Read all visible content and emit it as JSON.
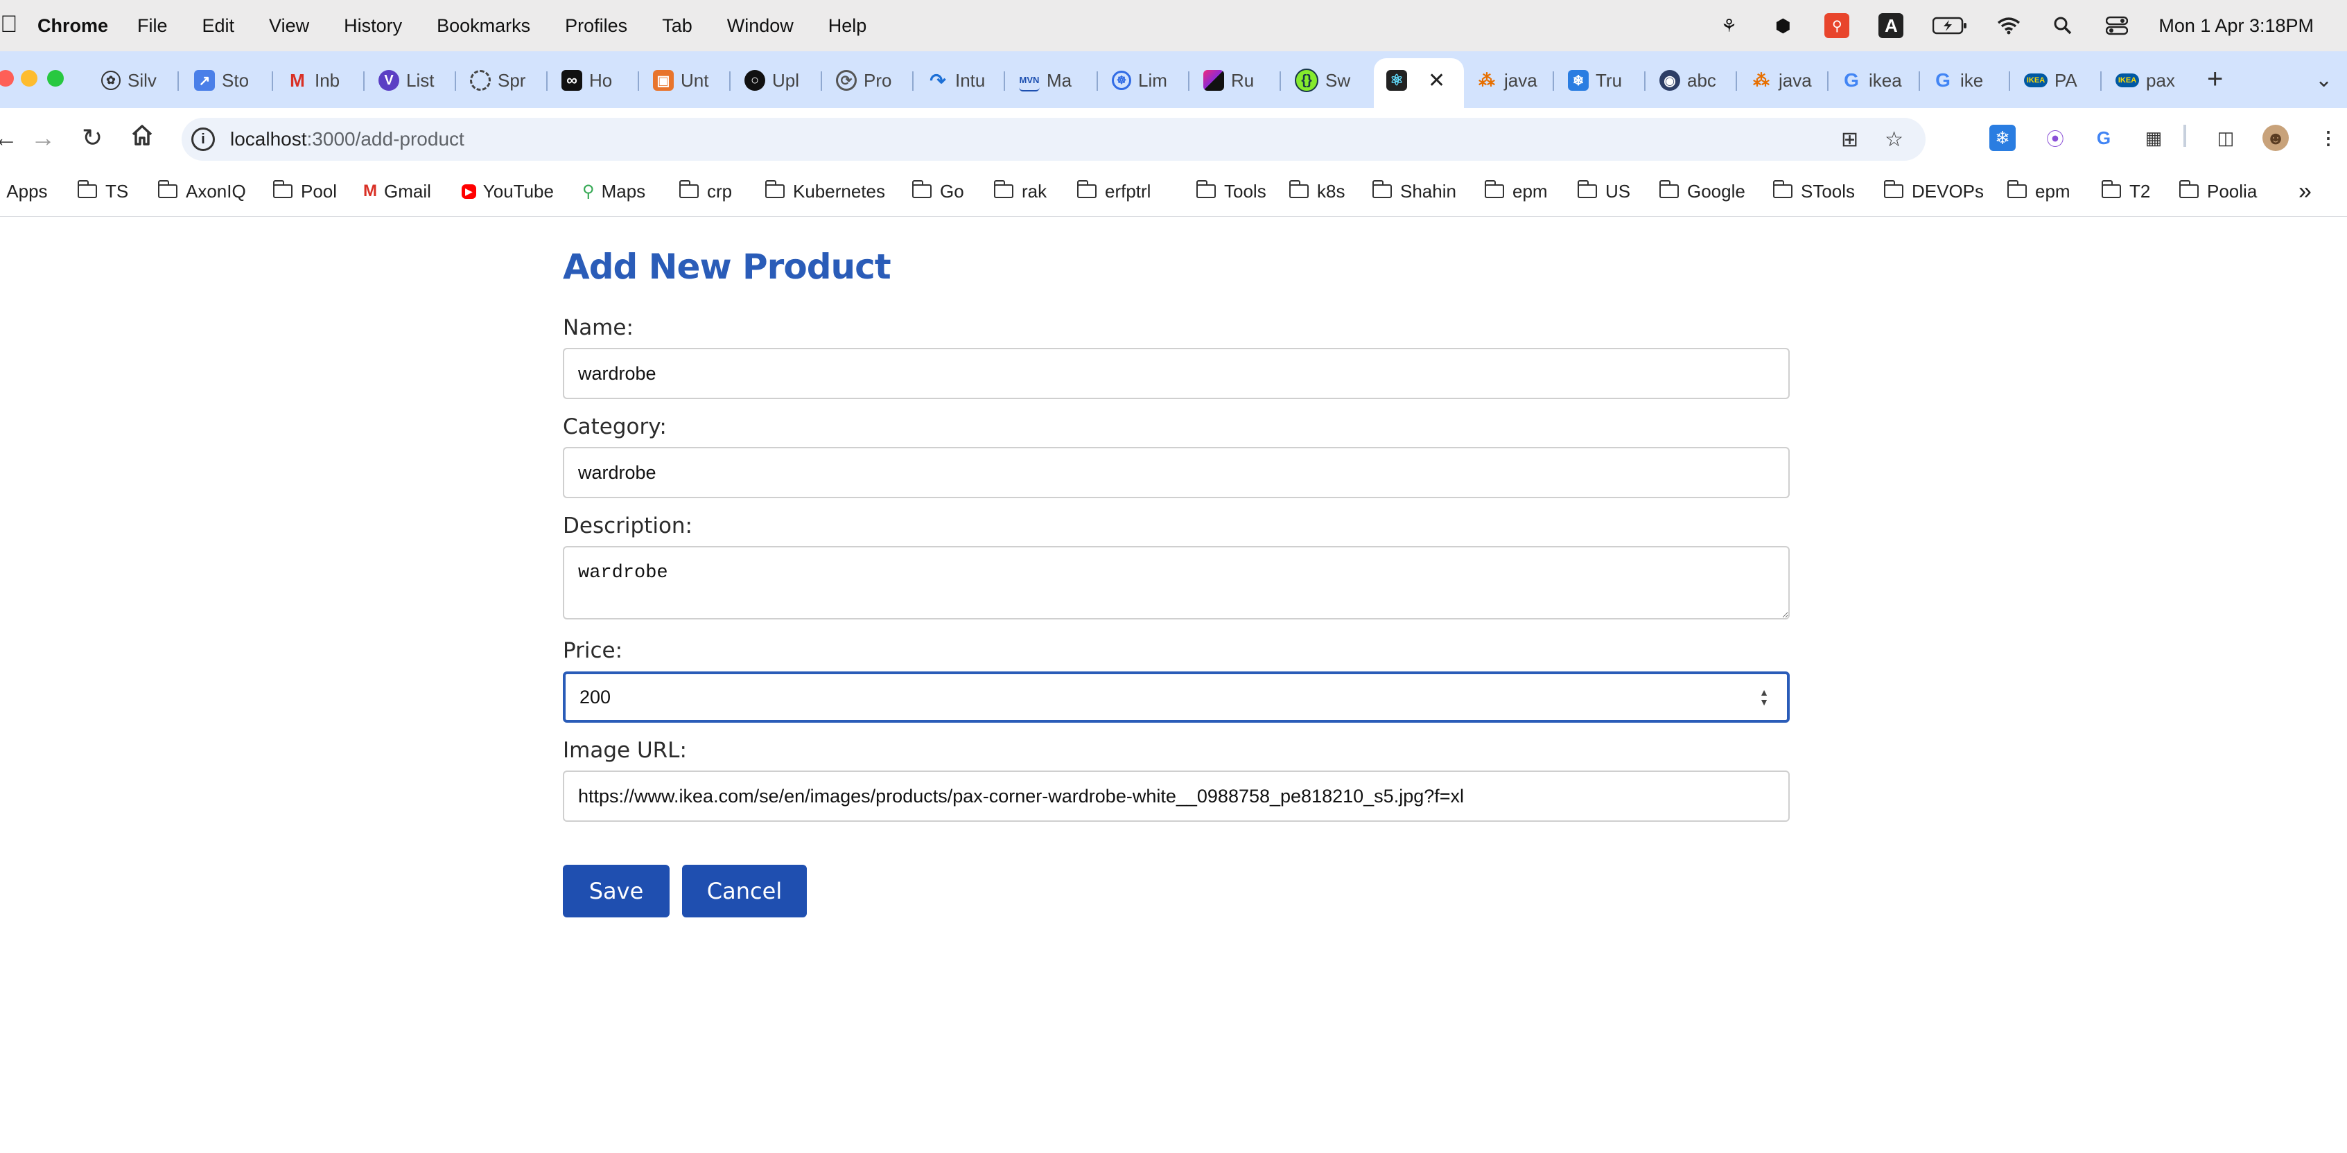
{
  "menubar": {
    "app_name": "Chrome",
    "menus": [
      "File",
      "Edit",
      "View",
      "History",
      "Bookmarks",
      "Profiles",
      "Tab",
      "Window",
      "Help"
    ],
    "clock": "Mon 1 Apr  3:18PM"
  },
  "tabs": [
    {
      "label": "Silv",
      "icon": "openai-icon"
    },
    {
      "label": "Sto",
      "icon": "chart-icon"
    },
    {
      "label": "Inb",
      "icon": "gmail-icon"
    },
    {
      "label": "List",
      "icon": "v-logo-icon"
    },
    {
      "label": "Spr",
      "icon": "circle-icon"
    },
    {
      "label": "Ho",
      "icon": "infinity-icon"
    },
    {
      "label": "Unt",
      "icon": "box-icon"
    },
    {
      "label": "Upl",
      "icon": "github-icon"
    },
    {
      "label": "Pro",
      "icon": "swirl-icon"
    },
    {
      "label": "Intu",
      "icon": "intellij-icon"
    },
    {
      "label": "Ma",
      "icon": "mvn-icon"
    },
    {
      "label": "Lim",
      "icon": "kubernetes-icon"
    },
    {
      "label": "Ru",
      "icon": "jetbrains-icon"
    },
    {
      "label": "Sw",
      "icon": "swagger-icon"
    },
    {
      "label": "",
      "icon": "react-icon",
      "active": true
    },
    {
      "label": "java",
      "icon": "java-icon"
    },
    {
      "label": "Tru",
      "icon": "snowflake-icon"
    },
    {
      "label": "abc",
      "icon": "eye-icon"
    },
    {
      "label": "java",
      "icon": "java-icon"
    },
    {
      "label": "ikea",
      "icon": "google-icon"
    },
    {
      "label": "ike",
      "icon": "google-icon"
    },
    {
      "label": "PA",
      "icon": "ikea-icon"
    },
    {
      "label": "pax",
      "icon": "ikea-icon"
    }
  ],
  "address_bar": {
    "host": "localhost",
    "path": ":3000/add-product"
  },
  "bookmarks": [
    {
      "label": "Apps",
      "type": "apps"
    },
    {
      "label": "TS",
      "type": "folder"
    },
    {
      "label": "AxonIQ",
      "type": "folder"
    },
    {
      "label": "Pool",
      "type": "folder"
    },
    {
      "label": "Gmail",
      "type": "gmail"
    },
    {
      "label": "YouTube",
      "type": "youtube"
    },
    {
      "label": "Maps",
      "type": "maps"
    },
    {
      "label": "crp",
      "type": "folder"
    },
    {
      "label": "Kubernetes",
      "type": "folder"
    },
    {
      "label": "Go",
      "type": "folder"
    },
    {
      "label": "rak",
      "type": "folder"
    },
    {
      "label": "erfptrl",
      "type": "folder"
    },
    {
      "label": "Tools",
      "type": "folder"
    },
    {
      "label": "k8s",
      "type": "folder"
    },
    {
      "label": "Shahin",
      "type": "folder"
    },
    {
      "label": "epm",
      "type": "folder"
    },
    {
      "label": "US",
      "type": "folder"
    },
    {
      "label": "Google",
      "type": "folder"
    },
    {
      "label": "STools",
      "type": "folder"
    },
    {
      "label": "DEVOPs",
      "type": "folder"
    },
    {
      "label": "epm",
      "type": "folder"
    },
    {
      "label": "T2",
      "type": "folder"
    },
    {
      "label": "Poolia",
      "type": "folder"
    }
  ],
  "form": {
    "title": "Add New Product",
    "name_label": "Name:",
    "name_value": "wardrobe",
    "category_label": "Category:",
    "category_value": "wardrobe",
    "description_label": "Description:",
    "description_value": "wardrobe",
    "price_label": "Price:",
    "price_value": "200",
    "image_url_label": "Image URL:",
    "image_url_value": "https://www.ikea.com/se/en/images/products/pax-corner-wardrobe-white__0988758_pe818210_s5.jpg?f=xl",
    "save_label": "Save",
    "cancel_label": "Cancel"
  },
  "colors": {
    "accent": "#2a5cb8",
    "button": "#1f4fb0",
    "tabstrip": "#d3e3fd"
  }
}
